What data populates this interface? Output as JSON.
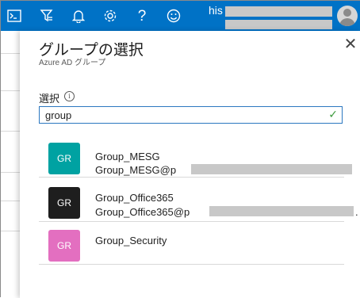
{
  "topbar": {
    "bg_color": "#0072c6",
    "icons": [
      "terminal-icon",
      "filter-icon",
      "bell-icon",
      "gear-icon",
      "help-icon",
      "smiley-icon"
    ],
    "icon_glyphs": {
      "terminal": ">_",
      "filter": "⛉",
      "bell": "🔔",
      "gear": "⚙",
      "help": "?",
      "smiley": "☺"
    },
    "user_prefix": "his"
  },
  "panel": {
    "title": "グループの選択",
    "subtitle": "Azure AD グループ",
    "close_glyph": "✕"
  },
  "search": {
    "label": "選択",
    "info_glyph": "i",
    "value": "group",
    "check_glyph": "✓"
  },
  "results": [
    {
      "initials": "GR",
      "name": "Group_MESG",
      "email": "Group_MESG@p",
      "color": "#00a2a2"
    },
    {
      "initials": "GR",
      "name": "Group_Office365",
      "email": "Group_Office365@p",
      "suffix": ".",
      "color": "#1e1e1e"
    },
    {
      "initials": "GR",
      "name": "Group_Security",
      "color": "#e36fc0"
    }
  ]
}
